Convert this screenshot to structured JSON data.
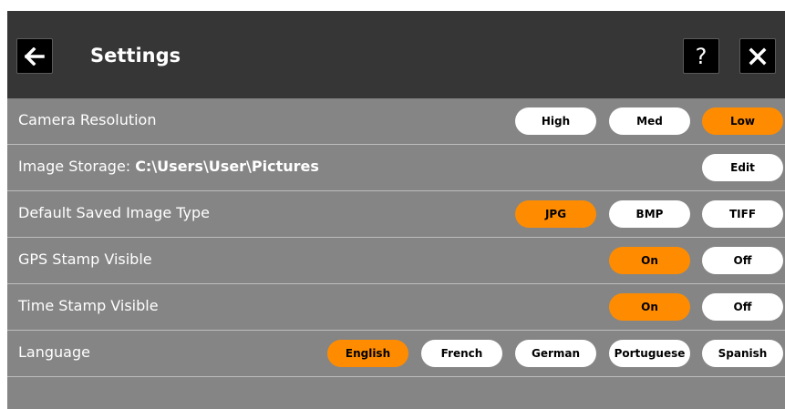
{
  "header": {
    "title": "Settings",
    "back_icon": "arrow-left-icon",
    "help_label": "?",
    "close_icon": "close-icon"
  },
  "colors": {
    "header_bg": "#363636",
    "panel_bg": "#858585",
    "active": "#ff8c00",
    "inactive": "#ffffff"
  },
  "settings": {
    "camera_resolution": {
      "label": "Camera Resolution",
      "options": [
        "High",
        "Med",
        "Low"
      ],
      "selected": "Low"
    },
    "image_storage": {
      "label": "Image Storage:",
      "path": "C:\\Users\\User\\Pictures",
      "edit_label": "Edit"
    },
    "image_type": {
      "label": "Default Saved Image Type",
      "options": [
        "JPG",
        "BMP",
        "TIFF"
      ],
      "selected": "JPG"
    },
    "gps_stamp": {
      "label": "GPS Stamp Visible",
      "options": [
        "On",
        "Off"
      ],
      "selected": "On"
    },
    "time_stamp": {
      "label": "Time Stamp Visible",
      "options": [
        "On",
        "Off"
      ],
      "selected": "On"
    },
    "language": {
      "label": "Language",
      "options": [
        "English",
        "French",
        "German",
        "Portuguese",
        "Spanish"
      ],
      "selected": "English"
    }
  }
}
